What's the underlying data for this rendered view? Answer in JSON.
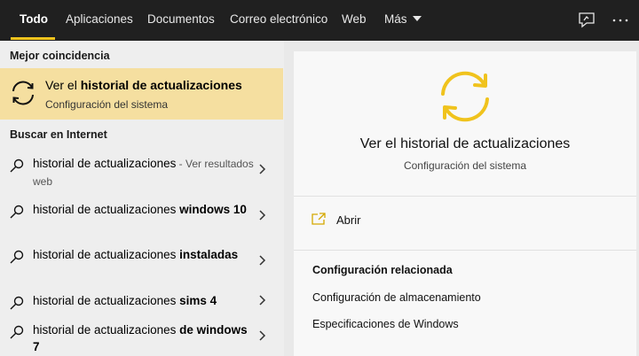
{
  "tabs": [
    {
      "label": "Todo",
      "active": true
    },
    {
      "label": "Aplicaciones"
    },
    {
      "label": "Documentos"
    },
    {
      "label": "Correo electrónico"
    },
    {
      "label": "Web"
    },
    {
      "label": "Más"
    }
  ],
  "top_icons": [
    "feedback-icon",
    "more-options-icon"
  ],
  "left": {
    "best_match_heading": "Mejor coincidencia",
    "best_match": {
      "title_prefix": "Ver el ",
      "title_bold": "historial de actualizaciones",
      "subtitle": "Configuración del sistema",
      "icon": "update-sync-icon"
    },
    "web_heading": "Buscar en Internet",
    "web_results": [
      {
        "prefix": "historial de actualizaciones",
        "bold": "",
        "suffix": " - Ver resultados web"
      },
      {
        "prefix": "historial de actualizaciones ",
        "bold": "windows 10",
        "suffix": ""
      },
      {
        "prefix": "historial de actualizaciones ",
        "bold": "instaladas",
        "suffix": ""
      },
      {
        "prefix": "historial de actualizaciones ",
        "bold": "sims 4",
        "suffix": ""
      },
      {
        "prefix": "historial de actualizaciones ",
        "bold": "de windows 7",
        "suffix": ""
      }
    ]
  },
  "right": {
    "title": "Ver el historial de actualizaciones",
    "subtitle": "Configuración del sistema",
    "open_label": "Abrir",
    "related_heading": "Configuración relacionada",
    "related_links": [
      "Configuración de almacenamiento",
      "Especificaciones de Windows"
    ]
  },
  "colors": {
    "accent": "#f0c31d",
    "highlight": "#f5dfa0",
    "topbar": "#202020"
  }
}
